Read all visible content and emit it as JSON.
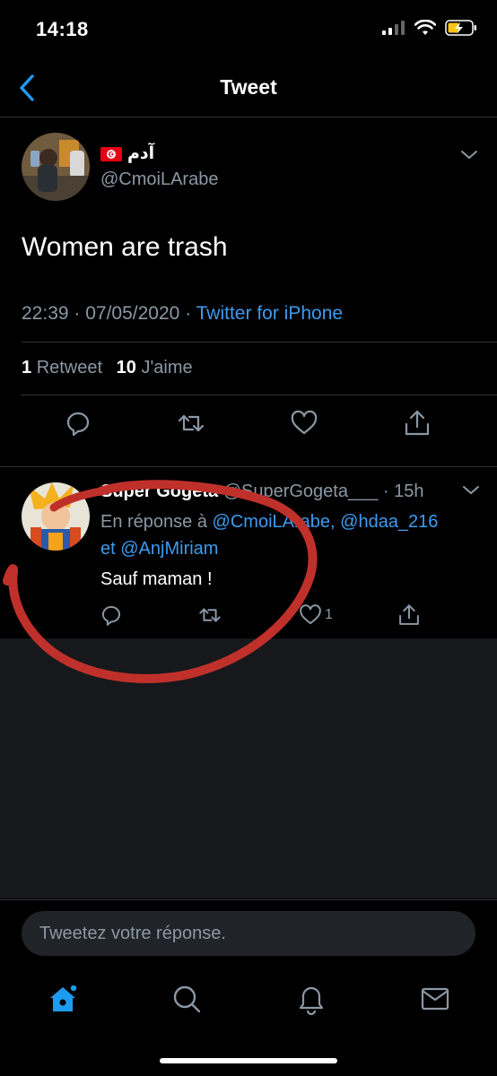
{
  "status_bar": {
    "time": "14:18"
  },
  "nav": {
    "title": "Tweet"
  },
  "main_tweet": {
    "display_name": "آدم",
    "handle": "@CmoiLArabe",
    "text": "Women are trash",
    "time": "22:39",
    "date": "07/05/2020",
    "source": "Twitter for iPhone",
    "retweet_count": "1",
    "retweet_label": "Retweet",
    "like_count": "10",
    "like_label": "J'aime"
  },
  "reply": {
    "display_name": "Super Gogeta",
    "handle": "@SuperGogeta___",
    "age": "15h",
    "context_prefix": "En réponse à",
    "mention_1": "@CmoiLArabe,",
    "mention_2": "@hdaa_216",
    "context_and": "et",
    "mention_3": "@AnjMiriam",
    "text": "Sauf maman !",
    "like_count": "1"
  },
  "compose": {
    "placeholder": "Tweetez votre réponse."
  },
  "icons": {
    "back": "chevron-left-icon",
    "reply": "comment-icon",
    "retweet": "retweet-icon",
    "like": "heart-icon",
    "share": "share-icon",
    "home": "home-icon",
    "search": "search-icon",
    "notifications": "bell-icon",
    "messages": "envelope-icon"
  },
  "colors": {
    "accent": "#1d9bf0",
    "annotation": "#c0302b",
    "muted": "#8b98a5"
  }
}
